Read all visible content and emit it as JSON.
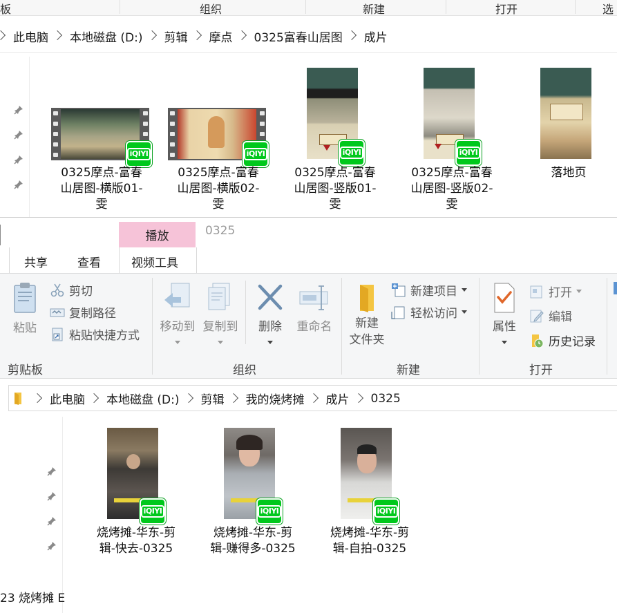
{
  "top_window": {
    "ribbon_group_labels": [
      "板",
      "组织",
      "新建",
      "打开",
      "选"
    ],
    "address": [
      "此电脑",
      "本地磁盘 (D:)",
      "剪辑",
      "摩点",
      "0325富春山居图",
      "成片"
    ],
    "files": [
      {
        "name": "0325摩点-富春山居图-横版01-雯",
        "line1": "0325摩点-富春",
        "line2": "山居图-横版01-",
        "line3": "雯"
      },
      {
        "name": "0325摩点-富春山居图-横版02-雯",
        "line1": "0325摩点-富春",
        "line2": "山居图-横版02-",
        "line3": "雯"
      },
      {
        "name": "0325摩点-富春山居图-竖版01-雯",
        "line1": "0325摩点-富春",
        "line2": "山居图-竖版01-",
        "line3": "雯"
      },
      {
        "name": "0325摩点-富春山居图-竖版02-雯",
        "line1": "0325摩点-富春",
        "line2": "山居图-竖版02-",
        "line3": "雯"
      },
      {
        "name": "落地页",
        "line1": "落地页",
        "line2": "",
        "line3": ""
      }
    ],
    "badge_text": "iQIYI"
  },
  "bottom_window": {
    "window_title": "0325",
    "tabs": {
      "share": "共享",
      "view": "查看",
      "context_group": "播放",
      "context_tab": "视频工具"
    },
    "ribbon": {
      "clipboard": {
        "paste": "粘贴",
        "cut": "剪切",
        "copy_path": "复制路径",
        "paste_shortcut": "粘贴快捷方式",
        "group": "剪贴板"
      },
      "organize": {
        "move_to": "移动到",
        "copy_to": "复制到",
        "delete": "删除",
        "rename": "重命名",
        "group": "组织"
      },
      "new": {
        "new_folder_line1": "新建",
        "new_folder_line2": "文件夹",
        "new_item": "新建项目",
        "easy_access": "轻松访问",
        "group": "新建"
      },
      "open": {
        "properties": "属性",
        "open": "打开",
        "edit": "编辑",
        "history": "历史记录",
        "group": "打开"
      }
    },
    "address": [
      "此电脑",
      "本地磁盘 (D:)",
      "剪辑",
      "我的烧烤摊",
      "成片",
      "0325"
    ],
    "files": [
      {
        "name": "烧烤摊-华东-剪辑-快去-0325",
        "line1": "烧烤摊-华东-剪",
        "line2": "辑-快去-0325"
      },
      {
        "name": "烧烤摊-华东-剪辑-赚得多-0325",
        "line1": "烧烤摊-华东-剪",
        "line2": "辑-赚得多-0325"
      },
      {
        "name": "烧烤摊-华东-剪辑-自拍-0325",
        "line1": "烧烤摊-华东-剪",
        "line2": "辑-自拍-0325"
      }
    ],
    "nav_partial_item": "23 烧烤摊 E"
  },
  "colors": {
    "context_tab": "#f6c3d8",
    "iqiyi_badge": "#00c81c",
    "folder": "#f4c542"
  }
}
